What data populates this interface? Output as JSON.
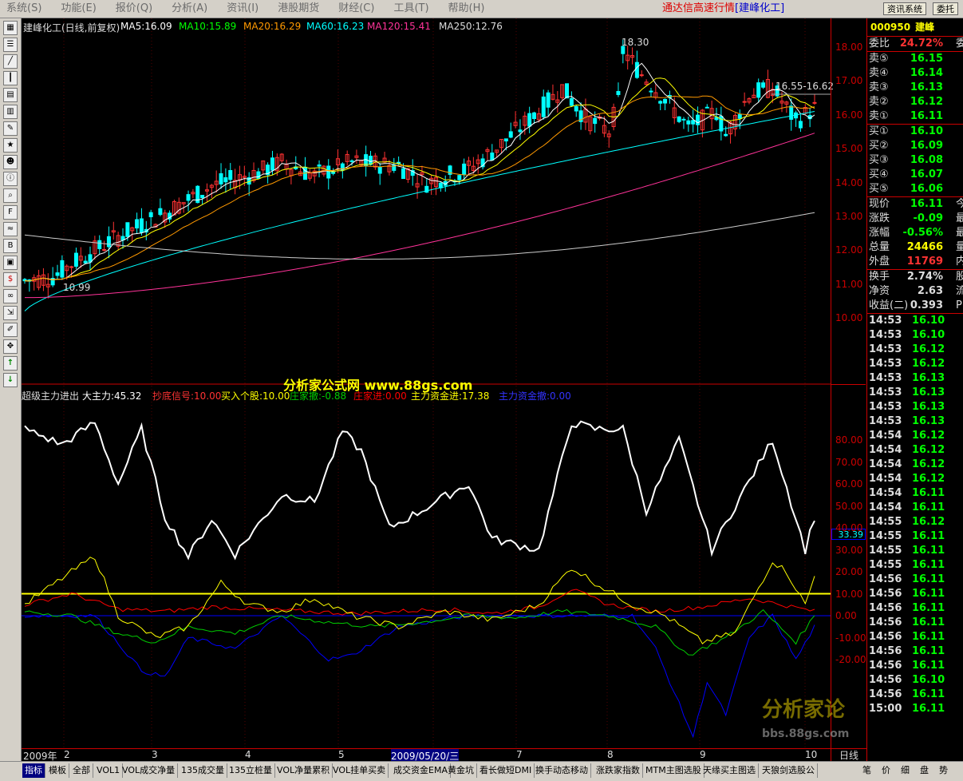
{
  "menu": {
    "items": [
      "系统(S)",
      "功能(E)",
      "报价(Q)",
      "分析(A)",
      "资讯(I)",
      "港股期货",
      "财经(C)",
      "工具(T)",
      "帮助(H)"
    ],
    "brand_text": "通达信高速行情",
    "brand_stock": "[建峰化工]",
    "btn_news": "资讯系统",
    "btn_order": "委托"
  },
  "toolbar_icons": [
    "grid-icon",
    "list-icon",
    "chart-icon",
    "kline-icon",
    "table-icon",
    "table2-icon",
    "notes-icon",
    "star-icon",
    "people-icon",
    "info-icon",
    "search-icon",
    "f10-icon",
    "trend-icon",
    "bsi-icon",
    "image-icon",
    "dollar-icon",
    "link-icon",
    "export-icon",
    "pencil-icon",
    "move-icon",
    "up-arrow-icon",
    "down-arrow-icon"
  ],
  "kline_legend": {
    "title": "建峰化工(日线,前复权)",
    "ma5": "MA5:16.09",
    "ma10": "MA10:15.89",
    "ma20": "MA20:16.29",
    "ma60": "MA60:16.23",
    "ma120": "MA120:15.41",
    "ma250": "MA250:12.76"
  },
  "kline_annotations": {
    "high": "18.30",
    "low": "10.99",
    "range": "16.55-16.62"
  },
  "kline_axis": [
    "18.00",
    "17.00",
    "16.00",
    "15.00",
    "14.00",
    "13.00",
    "12.00",
    "11.00",
    "10.00"
  ],
  "indicator_legend": {
    "name": "超级主力进出",
    "big": "大主力:45.32",
    "bottom": "抄底信号:10.00",
    "buy": "买入个股:10.00",
    "zhuang_out": "庄家撤:-0.88",
    "zhuang_in": "庄家进:0.00",
    "main_in": "主力资金进:17.38",
    "main_out": "主力资金撤:0.00"
  },
  "indicator_axis": [
    "80.00",
    "70.00",
    "60.00",
    "50.00",
    "40.00",
    "30.00",
    "20.00",
    "10.00",
    "0.00",
    "-10.00",
    "-20.00"
  ],
  "indicator_current": "33.39",
  "watermark": "分析家公式网 www.88gs.com",
  "watermark2": "分析家论",
  "watermark2_sub": "bbs.88gs.com",
  "xaxis": {
    "labels": [
      "2009年",
      "2",
      "3",
      "4",
      "5",
      "2009/05/20/三",
      "7",
      "8",
      "9",
      "10"
    ],
    "period": "日线"
  },
  "quote": {
    "code": "000950",
    "name": "建峰",
    "weibi_label": "委比",
    "weibi": "24.72%",
    "weibi_suffix": "委",
    "asks": [
      {
        "label": "卖⑤",
        "price": "16.15"
      },
      {
        "label": "卖④",
        "price": "16.14"
      },
      {
        "label": "卖③",
        "price": "16.13"
      },
      {
        "label": "卖②",
        "price": "16.12"
      },
      {
        "label": "卖①",
        "price": "16.11"
      }
    ],
    "bids": [
      {
        "label": "买①",
        "price": "16.10"
      },
      {
        "label": "买②",
        "price": "16.09"
      },
      {
        "label": "买③",
        "price": "16.08"
      },
      {
        "label": "买④",
        "price": "16.07"
      },
      {
        "label": "买⑤",
        "price": "16.06"
      }
    ],
    "stats1": [
      {
        "label": "现价",
        "value": "16.11",
        "suffix": "今",
        "color": "#00ff00"
      },
      {
        "label": "涨跌",
        "value": "-0.09",
        "suffix": "最",
        "color": "#00ff00"
      },
      {
        "label": "涨幅",
        "value": "-0.56%",
        "suffix": "最",
        "color": "#00ff00"
      },
      {
        "label": "总量",
        "value": "24466",
        "suffix": "量",
        "color": "#ffff00"
      },
      {
        "label": "外盘",
        "value": "11769",
        "suffix": "内",
        "color": "#ff3333"
      }
    ],
    "stats2": [
      {
        "label": "换手",
        "value": "2.74%",
        "suffix": "股",
        "color": "#dddddd"
      },
      {
        "label": "净资",
        "value": "2.63",
        "suffix": "流",
        "color": "#dddddd"
      },
      {
        "label": "收益(二)",
        "value": "0.393",
        "suffix": "PE",
        "color": "#dddddd"
      }
    ],
    "ticks": [
      {
        "t": "14:53",
        "p": "16.10",
        "c": "#00ff00"
      },
      {
        "t": "14:53",
        "p": "16.10",
        "c": "#00ff00"
      },
      {
        "t": "14:53",
        "p": "16.12",
        "c": "#00ff00"
      },
      {
        "t": "14:53",
        "p": "16.12",
        "c": "#00ff00"
      },
      {
        "t": "14:53",
        "p": "16.13",
        "c": "#00ff00"
      },
      {
        "t": "14:53",
        "p": "16.13",
        "c": "#00ff00"
      },
      {
        "t": "14:53",
        "p": "16.13",
        "c": "#00ff00"
      },
      {
        "t": "14:53",
        "p": "16.13",
        "c": "#00ff00"
      },
      {
        "t": "14:54",
        "p": "16.12",
        "c": "#00ff00"
      },
      {
        "t": "14:54",
        "p": "16.12",
        "c": "#00ff00"
      },
      {
        "t": "14:54",
        "p": "16.12",
        "c": "#00ff00"
      },
      {
        "t": "14:54",
        "p": "16.12",
        "c": "#00ff00"
      },
      {
        "t": "14:54",
        "p": "16.11",
        "c": "#00ff00"
      },
      {
        "t": "14:54",
        "p": "16.11",
        "c": "#00ff00"
      },
      {
        "t": "14:55",
        "p": "16.12",
        "c": "#00ff00"
      },
      {
        "t": "14:55",
        "p": "16.11",
        "c": "#00ff00"
      },
      {
        "t": "14:55",
        "p": "16.11",
        "c": "#00ff00"
      },
      {
        "t": "14:55",
        "p": "16.11",
        "c": "#00ff00"
      },
      {
        "t": "14:56",
        "p": "16.11",
        "c": "#00ff00"
      },
      {
        "t": "14:56",
        "p": "16.11",
        "c": "#00ff00"
      },
      {
        "t": "14:56",
        "p": "16.11",
        "c": "#00ff00"
      },
      {
        "t": "14:56",
        "p": "16.11",
        "c": "#00ff00"
      },
      {
        "t": "14:56",
        "p": "16.11",
        "c": "#00ff00"
      },
      {
        "t": "14:56",
        "p": "16.11",
        "c": "#00ff00"
      },
      {
        "t": "14:56",
        "p": "16.11",
        "c": "#00ff00"
      },
      {
        "t": "14:56",
        "p": "16.10",
        "c": "#00ff00"
      },
      {
        "t": "14:56",
        "p": "16.11",
        "c": "#00ff00"
      },
      {
        "t": "15:00",
        "p": "16.11",
        "c": "#00ff00"
      }
    ]
  },
  "tabs": [
    "指标",
    "模板",
    "全部",
    "VOL1",
    "VOL成交净量",
    "135成交量",
    "135立桩量",
    "VOL净量累积",
    "VOL挂单买卖",
    "成交资金EMA",
    "黄金坑",
    "看长做短DMI",
    "换手动态移动",
    "涨跌家指数",
    "MTM主图选股",
    "天缘买主图选",
    "天狼剑选股公"
  ],
  "bottom_right": [
    "笔",
    "价",
    "细",
    "盘",
    "势"
  ],
  "colors": {
    "up": "#ff3232",
    "down": "#00ffff",
    "ma5": "#ffffff",
    "ma10": "#ffff00",
    "ma20": "#ff9900",
    "ma60": "#00ff00",
    "ma120": "#ff3399",
    "ma250": "#cccccc",
    "big": "#ffffff",
    "yellow": "#ffff00",
    "red": "#ff0000",
    "green": "#00cc00",
    "blue": "#0000ff"
  }
}
